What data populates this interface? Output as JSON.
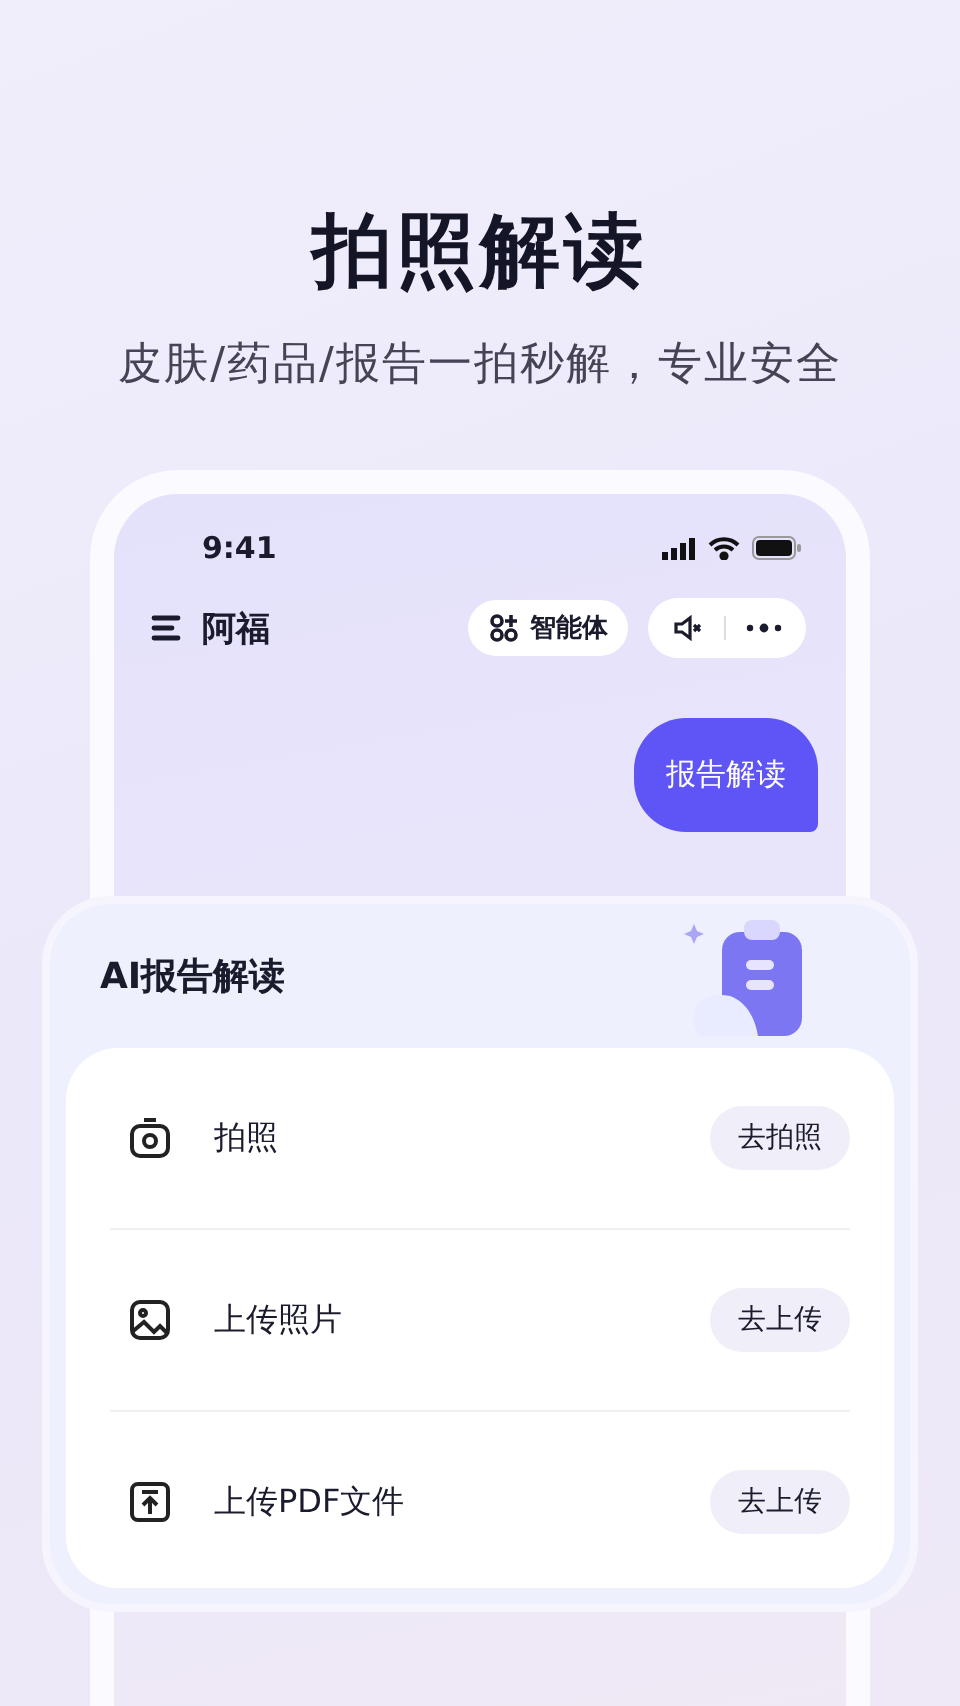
{
  "headline": "拍照解读",
  "subtitle": "皮肤/药品/报告一拍秒解，专业安全",
  "phone": {
    "status_bar": {
      "time": "9:41"
    },
    "header": {
      "title": "阿福",
      "agent_button": "智能体"
    },
    "message": "报告解读"
  },
  "card": {
    "title": "AI报告解读",
    "items": [
      {
        "kind": "camera",
        "label": "拍照",
        "action": "去拍照"
      },
      {
        "kind": "image",
        "label": "上传照片",
        "action": "去上传"
      },
      {
        "kind": "upload",
        "label": "上传PDF文件",
        "action": "去上传"
      }
    ]
  }
}
